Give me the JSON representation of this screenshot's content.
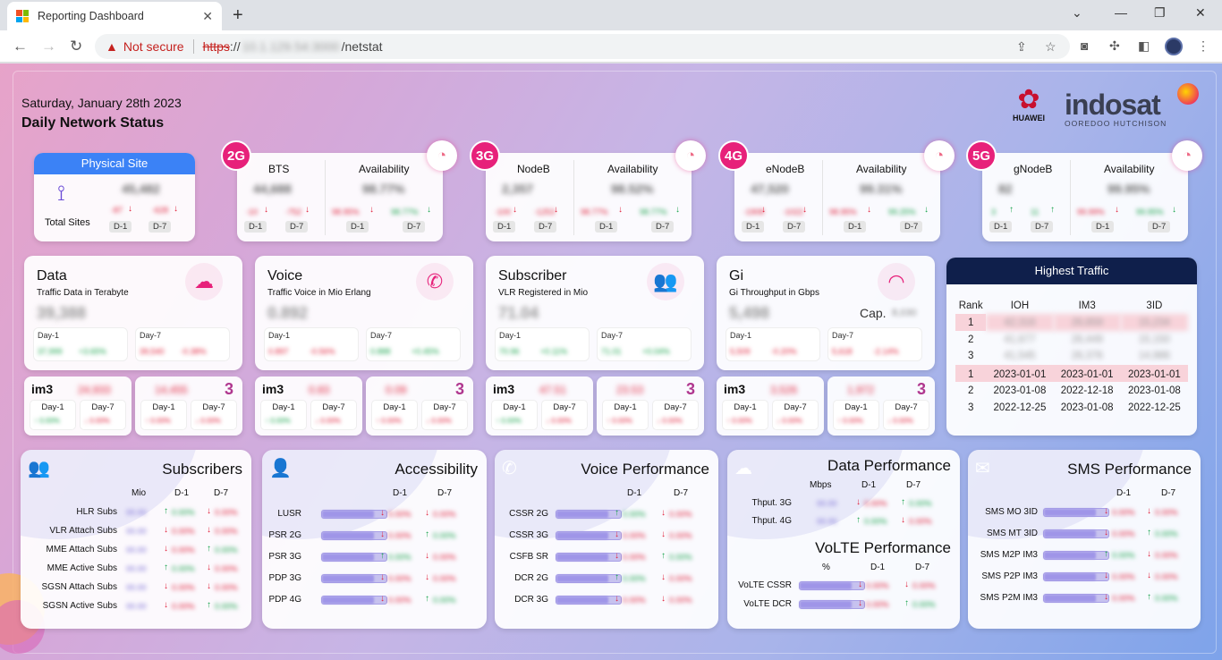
{
  "browser": {
    "tab_title": "Reporting Dashboard",
    "not_secure": "Not secure",
    "url_scheme": "https",
    "url_sep": "://",
    "url_host": "10.1.129.54:3000",
    "url_path": "/netstat",
    "new_tab": "+",
    "close_tab": "✕"
  },
  "header": {
    "date": "Saturday, January 28th 2023",
    "title": "Daily Network Status",
    "huawei": "HUAWEI",
    "indosat": "indosat",
    "indosat_sub": "OOREDOO HUTCHISON"
  },
  "physical_site": {
    "title": "Physical Site",
    "label": "Total Sites",
    "value": "45,482",
    "d1_val": "-87",
    "d7_val": "-628",
    "d1": "D-1",
    "d7": "D-7"
  },
  "tech": [
    {
      "badge": "2G",
      "count_label": "BTS",
      "count": "44,688",
      "c_d1": "-10",
      "c_d7": "-752",
      "avail_label": "Availability",
      "avail": "98.77%",
      "a_d1": "98.95%",
      "a_d7": "98.77%",
      "d1": "D-1",
      "d7": "D-7"
    },
    {
      "badge": "3G",
      "count_label": "NodeB",
      "count": "2,357",
      "c_d1": "-100",
      "c_d7": "-1253",
      "avail_label": "Availability",
      "avail": "98.52%",
      "a_d1": "98.77%",
      "a_d7": "98.77%",
      "d1": "D-1",
      "d7": "D-7"
    },
    {
      "badge": "4G",
      "count_label": "eNodeB",
      "count": "47,520",
      "c_d1": "-1908",
      "c_d7": "-1022",
      "avail_label": "Availability",
      "avail": "99.31%",
      "a_d1": "98.95%",
      "a_d7": "99.25%",
      "d1": "D-1",
      "d7": "D-7"
    },
    {
      "badge": "5G",
      "count_label": "gNodeB",
      "count": "82",
      "c_d1": "3",
      "c_d7": "11",
      "avail_label": "Availability",
      "avail": "99.95%",
      "a_d1": "99.99%",
      "a_d7": "99.95%",
      "d1": "D-1",
      "d7": "D-7"
    }
  ],
  "metrics": [
    {
      "title": "Data",
      "sub": "Traffic Data in Terabyte",
      "value": "39,388",
      "day1": "Day-1",
      "day7": "Day-7",
      "d1v": "37,999",
      "d1p": "+3.65%",
      "d7v": "39,540",
      "d7p": "-0.38%",
      "icon": "cloud-download-icon",
      "cap": ""
    },
    {
      "title": "Voice",
      "sub": "Traffic Voice in Mio Erlang",
      "value": "0.892",
      "day1": "Day-1",
      "day7": "Day-7",
      "d1v": "0.897",
      "d1p": "-0.56%",
      "d7v": "0.888",
      "d7p": "+0.45%",
      "icon": "phone-icon",
      "cap": ""
    },
    {
      "title": "Subscriber",
      "sub": "VLR Registered in Mio",
      "value": "71.04",
      "day1": "Day-1",
      "day7": "Day-7",
      "d1v": "70.96",
      "d1p": "+0.11%",
      "d7v": "71.01",
      "d7p": "+0.04%",
      "icon": "users-icon",
      "cap": ""
    },
    {
      "title": "Gi",
      "sub": "Gi Throughput in Gbps",
      "value": "5,498",
      "day1": "Day-1",
      "day7": "Day-7",
      "d1v": "5,509",
      "d1p": "-0.20%",
      "d7v": "5,618",
      "d7p": "-2.14%",
      "icon": "gauge-icon",
      "cap": "Cap.",
      "cap_val": "8,030"
    }
  ],
  "brands": {
    "im3": "im3",
    "three": "3",
    "day1": "Day-1",
    "day7": "Day-7"
  },
  "highest": {
    "title": "Highest Traffic",
    "headers": [
      "Rank",
      "IOH",
      "IM3",
      "3ID"
    ],
    "values": [
      [
        "1",
        "42,316",
        "26,859",
        "15,234"
      ],
      [
        "2",
        "41,677",
        "26,449",
        "15,150"
      ],
      [
        "3",
        "41,545",
        "26,376",
        "14,986"
      ]
    ],
    "dates": [
      [
        "1",
        "2023-01-01",
        "2023-01-01",
        "2023-01-01"
      ],
      [
        "2",
        "2023-01-08",
        "2022-12-18",
        "2023-01-08"
      ],
      [
        "3",
        "2022-12-25",
        "2023-01-08",
        "2022-12-25"
      ]
    ]
  },
  "subscribers": {
    "title": "Subscribers",
    "cols": [
      "Mio",
      "D-1",
      "D-7"
    ],
    "rows": [
      "HLR Subs",
      "VLR Attach Subs",
      "MME Attach Subs",
      "MME Active Subs",
      "SGSN Attach Subs",
      "SGSN Active Subs"
    ]
  },
  "accessibility": {
    "title": "Accessibility",
    "cols": [
      "D-1",
      "D-7"
    ],
    "rows": [
      "LUSR",
      "PSR 2G",
      "PSR 3G",
      "PDP 3G",
      "PDP 4G"
    ]
  },
  "voice_perf": {
    "title": "Voice Performance",
    "cols": [
      "D-1",
      "D-7"
    ],
    "rows": [
      "CSSR 2G",
      "CSSR 3G",
      "CSFB SR",
      "DCR 2G",
      "DCR 3G"
    ]
  },
  "data_perf": {
    "title": "Data Performance",
    "cols": [
      "Mbps",
      "D-1",
      "D-7"
    ],
    "rows": [
      "Thput. 3G",
      "Thput. 4G"
    ],
    "volte_title": "VoLTE Performance",
    "volte_cols": [
      "%",
      "D-1",
      "D-7"
    ],
    "volte_rows": [
      "VoLTE CSSR",
      "VoLTE DCR"
    ]
  },
  "sms_perf": {
    "title": "SMS Performance",
    "cols": [
      "D-1",
      "D-7"
    ],
    "rows": [
      "SMS MO 3ID",
      "SMS MT 3ID",
      "SMS M2P IM3",
      "SMS P2P IM3",
      "SMS P2M IM3"
    ]
  },
  "colors": {
    "accent": "#e7217a",
    "blue": "#3b82f6",
    "navy": "#0f1f4b",
    "red": "#e0203a",
    "green": "#16a34a"
  }
}
